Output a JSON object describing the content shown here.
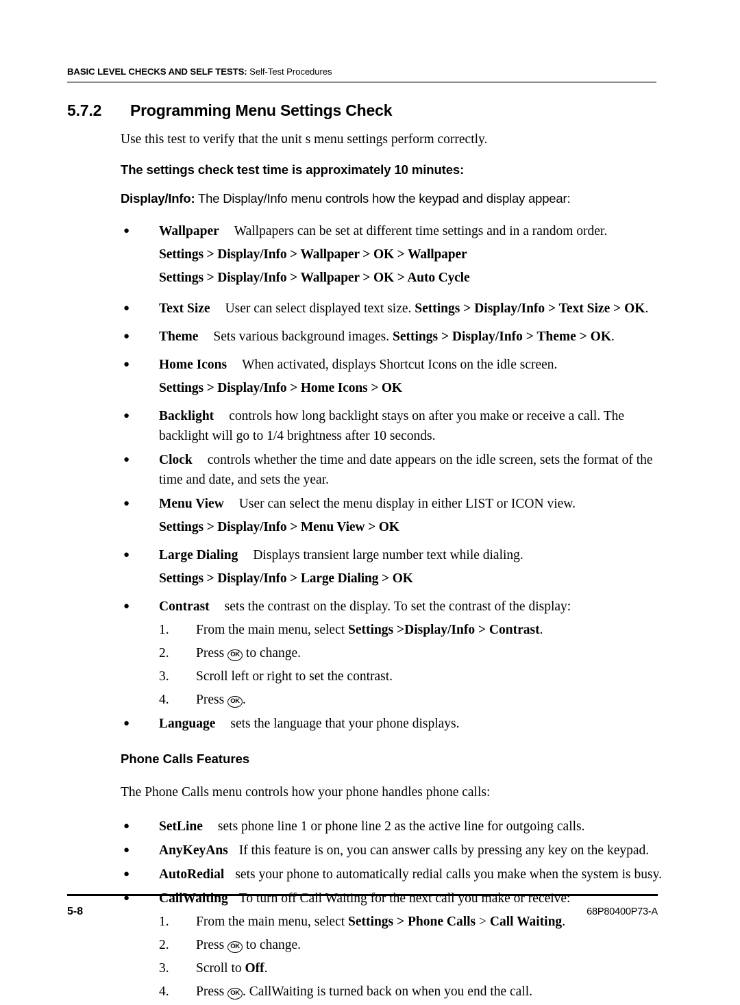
{
  "header": {
    "strong": "BASIC LEVEL CHECKS AND SELF TESTS:",
    "rest": " Self-Test Procedures"
  },
  "section": {
    "number": "5.7.2",
    "title": "Programming Menu Settings Check"
  },
  "intro": "Use this test to verify that the unit s menu settings perform correctly.",
  "time_note": "The settings check test time is approximately 10 minutes:",
  "display_info_lead": {
    "label": "Display/Info:",
    "text": " The Display/Info menu controls how the keypad and display appear:"
  },
  "display_info_bullets": {
    "wallpaper": {
      "term": "Wallpaper",
      "desc": "Wallpapers can be set at different time settings and in a random order.",
      "path1": "Settings > Display/Info > Wallpaper > OK > Wallpaper",
      "path2": "Settings > Display/Info > Wallpaper > OK > Auto Cycle"
    },
    "text_size": {
      "term": "Text Size",
      "desc": "User can select displayed text size. ",
      "path_inline": "Settings > Display/Info > Text Size > OK"
    },
    "theme": {
      "term": "Theme",
      "desc": "Sets various background images. ",
      "path_inline": "Settings > Display/Info > Theme > OK"
    },
    "home_icons": {
      "term": "Home Icons",
      "desc": "When activated, displays Shortcut Icons on the idle screen.",
      "path1": "Settings > Display/Info > Home Icons > OK"
    },
    "backlight": {
      "term": "Backlight",
      "desc": "controls how long backlight stays on after you make or receive a call. The backlight will go to 1/4 brightness after 10 seconds."
    },
    "clock": {
      "term": "Clock",
      "desc": "controls whether the time and date appears on the idle screen, sets the format of the time and date, and sets the year."
    },
    "menu_view": {
      "term": "Menu View",
      "desc": "User can select the menu display in either LIST or ICON view.",
      "path1": "Settings > Display/Info > Menu View > OK"
    },
    "large_dialing": {
      "term": "Large Dialing",
      "desc": "Displays transient large number text while dialing.",
      "path1": "Settings > Display/Info > Large Dialing > OK"
    },
    "contrast": {
      "term": "Contrast",
      "desc": "sets the contrast on the display. To set the contrast of the display:"
    },
    "language": {
      "term": "Language",
      "desc": "sets the language that your phone displays."
    }
  },
  "contrast_steps": [
    {
      "num": "1.",
      "pre": "From the main menu, select ",
      "bold": "Settings >Display/Info > Contrast",
      "post": "."
    },
    {
      "num": "2.",
      "pre": "Press ",
      "key": "OK",
      "post": " to change."
    },
    {
      "num": "3.",
      "pre": "Scroll left or right to set the contrast.",
      "post": ""
    },
    {
      "num": "4.",
      "pre": "Press ",
      "key": "OK",
      "post": "."
    }
  ],
  "phone_calls": {
    "subhead": "Phone Calls Features",
    "intro": "The Phone Calls menu controls how your phone handles phone calls:",
    "bullets": {
      "setline": {
        "term": "SetLine",
        "desc": "sets phone line 1 or phone line 2 as the active line for outgoing calls."
      },
      "anykeyans": {
        "term": "AnyKeyAns",
        "desc": "If this feature is on, you can answer calls by pressing any key on the keypad."
      },
      "autoredial": {
        "term": "AutoRedial",
        "desc": "sets your phone to automatically redial calls you make when the system is busy."
      },
      "callwaiting": {
        "term": "CallWaiting",
        "desc": "To turn off Call Waiting for the next call you make or receive:"
      }
    },
    "steps": [
      {
        "num": "1.",
        "pre": "From the main menu, select ",
        "bold1": "Settings > Phone Calls",
        "mid": " > ",
        "bold2": "Call Waiting",
        "post": "."
      },
      {
        "num": "2.",
        "pre": "Press ",
        "key": "OK",
        "post": " to change."
      },
      {
        "num": "3.",
        "pre": "Scroll to ",
        "bold": "Off",
        "post": "."
      },
      {
        "num": "4.",
        "pre": "Press ",
        "key": "OK",
        "post": ". CallWaiting is turned back on when you end the call."
      }
    ]
  },
  "footer": {
    "page_number": "5-8",
    "document_number": "68P80400P73-A"
  }
}
